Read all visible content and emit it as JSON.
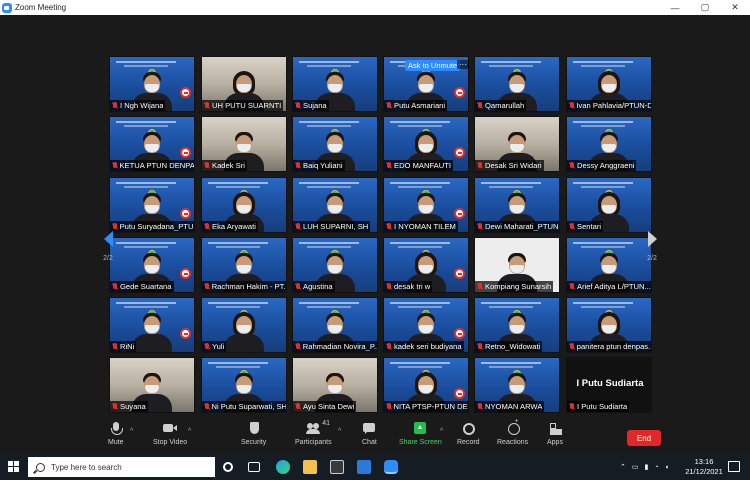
{
  "window": {
    "title": "Zoom Meeting",
    "controls": {
      "minimize": "—",
      "maximize": "▢",
      "close": "✕"
    }
  },
  "meeting": {
    "unmute_prompt": "Ask to Unmute",
    "more_options": "···",
    "page_left": "2/2",
    "page_right": "2/2",
    "participants": [
      {
        "name": "I Ngh Wijana",
        "muted": true,
        "style": "blue"
      },
      {
        "name": "UH PUTU SUARNTI",
        "muted": true,
        "style": "room"
      },
      {
        "name": "Sujana",
        "muted": true,
        "style": "blue"
      },
      {
        "name": "Putu Asmariani",
        "muted": true,
        "style": "blue"
      },
      {
        "name": "Qamarullah",
        "muted": true,
        "style": "blue"
      },
      {
        "name": "Ivan Pahlavia/PTUN-D...",
        "muted": true,
        "style": "blue"
      },
      {
        "name": "KETUA PTUN DENPA...",
        "muted": true,
        "style": "blue"
      },
      {
        "name": "Kadek Sri",
        "muted": true,
        "style": "room"
      },
      {
        "name": "Baiq Yuliani",
        "muted": true,
        "style": "blue"
      },
      {
        "name": "EDO MANFAUTI",
        "muted": true,
        "style": "blue"
      },
      {
        "name": "Desak Sri Widari",
        "muted": true,
        "style": "room"
      },
      {
        "name": "Dessy Anggraeni",
        "muted": true,
        "style": "blue"
      },
      {
        "name": "Putu Suryadana_PTU...",
        "muted": true,
        "style": "blue"
      },
      {
        "name": "Eka Aryawati",
        "muted": true,
        "style": "blue"
      },
      {
        "name": "LUH SUPARNI, SH",
        "muted": true,
        "style": "blue"
      },
      {
        "name": "I NYOMAN TILEM",
        "muted": true,
        "style": "blue"
      },
      {
        "name": "Dewi Maharati_PTUN",
        "muted": true,
        "style": "blue"
      },
      {
        "name": "Sentari",
        "muted": true,
        "style": "blue"
      },
      {
        "name": "Gede Suartana",
        "muted": true,
        "style": "blue"
      },
      {
        "name": "Rachman Hakim - PT...",
        "muted": true,
        "style": "blue"
      },
      {
        "name": "Agustina",
        "muted": true,
        "style": "blue"
      },
      {
        "name": "desak tri w",
        "muted": true,
        "style": "blue"
      },
      {
        "name": "Kompiang Sunarsih",
        "muted": true,
        "style": "white"
      },
      {
        "name": "Arief Aditya L/PTUN...",
        "muted": true,
        "style": "blue"
      },
      {
        "name": "RiNi",
        "muted": true,
        "style": "blue"
      },
      {
        "name": "Yuli",
        "muted": true,
        "style": "blue"
      },
      {
        "name": "Rahmadian Novira_P...",
        "muted": true,
        "style": "blue"
      },
      {
        "name": "kadek seri budiyana",
        "muted": true,
        "style": "blue"
      },
      {
        "name": "Retno_Widowati",
        "muted": true,
        "style": "blue"
      },
      {
        "name": "panitera ptun denpas...",
        "muted": true,
        "style": "blue"
      },
      {
        "name": "Suyana",
        "muted": true,
        "style": "room"
      },
      {
        "name": "Ni Putu Suparwati, SH...",
        "muted": true,
        "style": "blue"
      },
      {
        "name": "Ayu Sinta Dewi",
        "muted": true,
        "style": "room"
      },
      {
        "name": "NITA PTSP-PTUN DE...",
        "muted": true,
        "style": "blue"
      },
      {
        "name": "NYOMAN ARWA",
        "muted": true,
        "style": "blue"
      },
      {
        "name": "I Putu Sudiarta",
        "muted": true,
        "style": "text",
        "display_name": "I Putu Sudiarta"
      }
    ]
  },
  "toolbar": {
    "mute": "Mute",
    "stop_video": "Stop Video",
    "security": "Security",
    "participants": "Participants",
    "participants_count": "41",
    "chat": "Chat",
    "share_screen": "Share Screen",
    "record": "Record",
    "reactions": "Reactions",
    "apps": "Apps",
    "end": "End",
    "caret": "^"
  },
  "taskbar": {
    "search_placeholder": "Type here to search",
    "time": "13:16",
    "date": "21/12/2021"
  },
  "colors": {
    "accent": "#2d8cff",
    "end_button": "#e02828",
    "share_green": "#1fbf4a",
    "muted_red": "#e0302a"
  }
}
